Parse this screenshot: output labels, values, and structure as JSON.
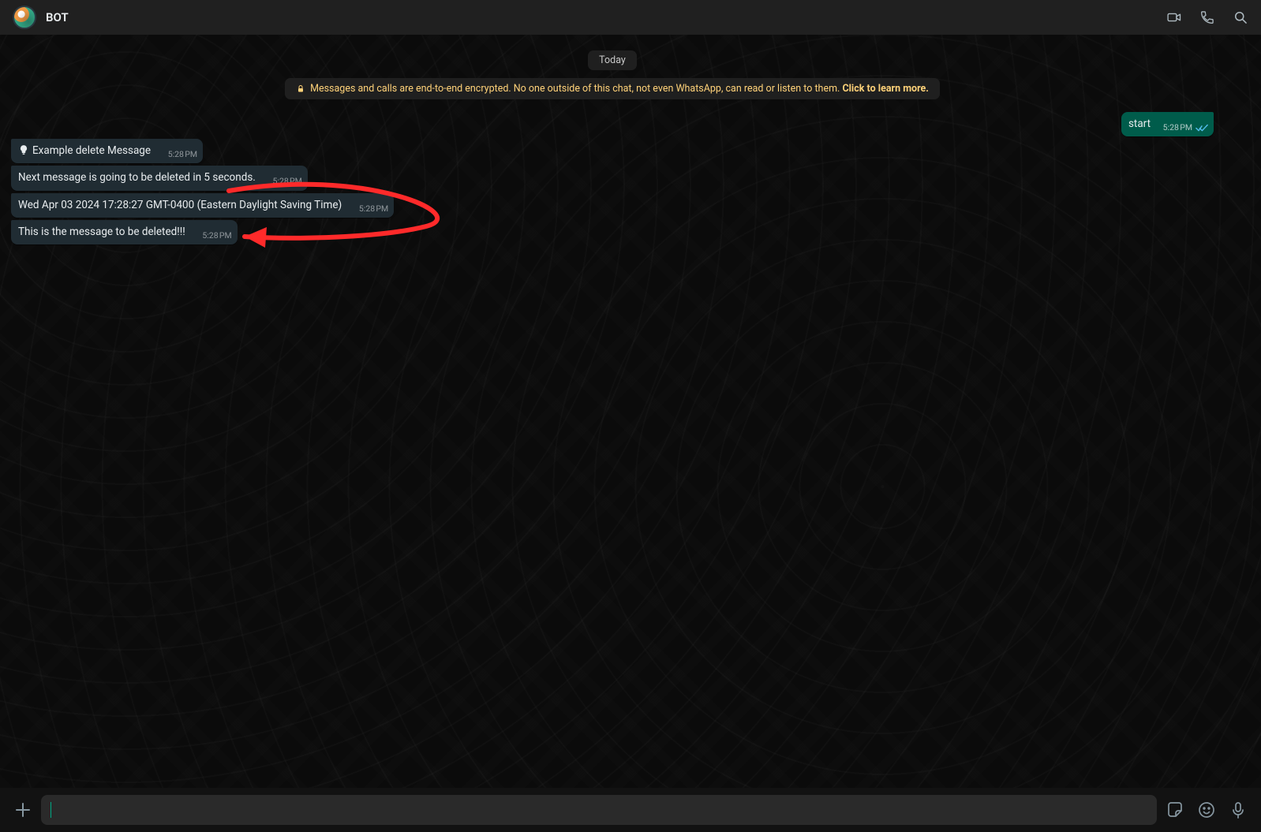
{
  "header": {
    "title": "BOT"
  },
  "chat": {
    "dayLabel": "Today",
    "encryption": {
      "text": "Messages and calls are end-to-end encrypted. No one outside of this chat, not even WhatsApp, can read or listen to them. ",
      "learnMore": "Click to learn more."
    },
    "messages": {
      "out1": {
        "text": "start",
        "time": "5:28 PM"
      },
      "in1": {
        "text": "Example delete Message",
        "time": "5:28 PM"
      },
      "in2": {
        "text": "Next message is going to be deleted in 5 seconds.",
        "time": "5:28 PM"
      },
      "in3": {
        "text": "Wed Apr 03 2024 17:28:27 GMT-0400 (Eastern Daylight Saving Time)",
        "time": "5:28 PM"
      },
      "in4": {
        "text": "This is the message to be deleted!!!",
        "time": "5:28 PM"
      }
    }
  },
  "composer": {
    "placeholder": ""
  },
  "colors": {
    "outgoingBubble": "#005c4b",
    "incomingBubble": "#202c33",
    "accent": "#00a884",
    "annotation": "#ff2a2a"
  }
}
